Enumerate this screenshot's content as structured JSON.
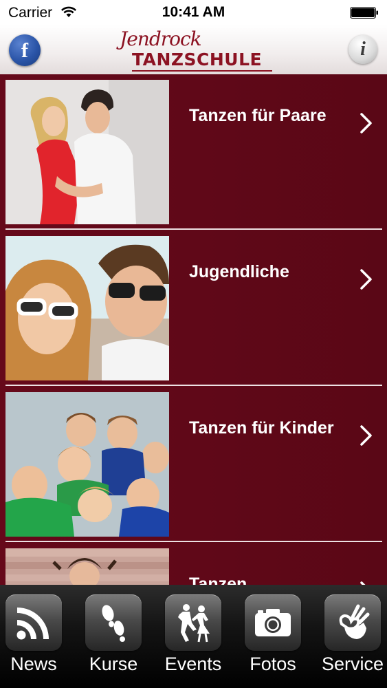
{
  "status_bar": {
    "carrier": "Carrier",
    "time": "10:41 AM"
  },
  "header": {
    "facebook_glyph": "f",
    "logo_script": "Jendrock",
    "logo_text": "TANZSCHULE",
    "info_glyph": "i"
  },
  "list": {
    "items": [
      {
        "title": "Tanzen für Paare",
        "image": "couple-photo"
      },
      {
        "title": "Jugendliche",
        "image": "teens-photo"
      },
      {
        "title": "Tanzen für Kinder",
        "image": "kids-photo"
      },
      {
        "title": "Tanzen",
        "image": "dancer-photo"
      }
    ]
  },
  "tab_bar": {
    "tabs": [
      {
        "label": "News",
        "icon": "rss-icon"
      },
      {
        "label": "Kurse",
        "icon": "footprints-icon"
      },
      {
        "label": "Events",
        "icon": "dancers-icon"
      },
      {
        "label": "Fotos",
        "icon": "camera-icon"
      },
      {
        "label": "Service",
        "icon": "ok-hand-icon"
      }
    ]
  },
  "colors": {
    "list_background": "#5c0715",
    "brand_red": "#8c1222",
    "tab_bar_background": "#141414"
  }
}
